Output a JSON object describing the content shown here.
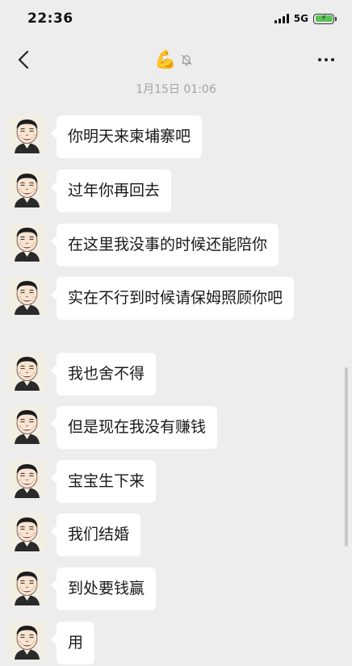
{
  "status_bar": {
    "time": "22:36",
    "network": "5G"
  },
  "nav": {
    "title_emoji": "💪"
  },
  "chat": {
    "timestamp": "1月15日 01:06",
    "messages": [
      {
        "text": "你明天来柬埔寨吧"
      },
      {
        "text": "过年你再回去"
      },
      {
        "text": "在这里我没事的时候还能陪你"
      },
      {
        "text": "实在不行到时候请保姆照顾你吧"
      },
      {
        "text": "我也舍不得"
      },
      {
        "text": "但是现在我没有赚钱"
      },
      {
        "text": "宝宝生下来"
      },
      {
        "text": "我们结婚"
      },
      {
        "text": "到处要钱赢"
      },
      {
        "text": "用"
      }
    ]
  }
}
